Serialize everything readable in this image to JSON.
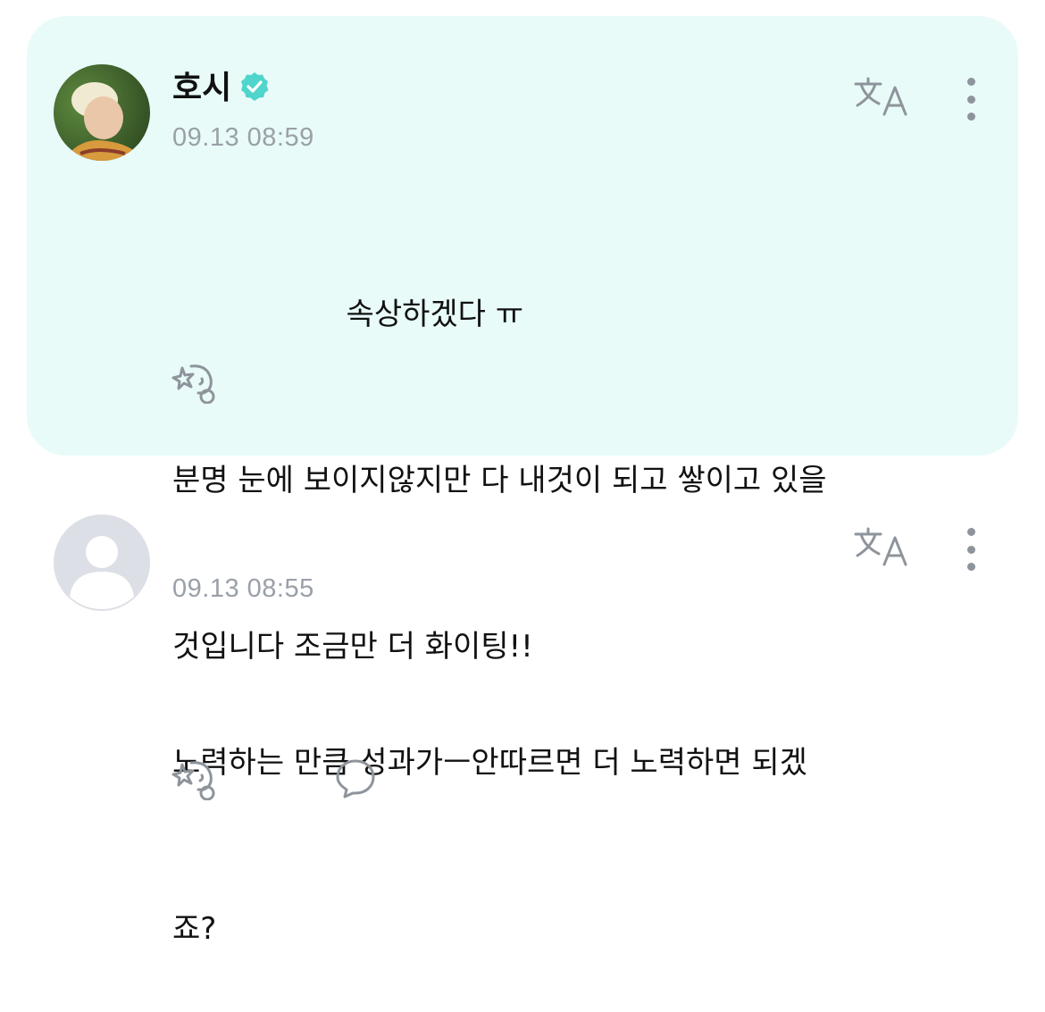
{
  "post": {
    "author": "호시",
    "verified": true,
    "timestamp": "09.13 08:59",
    "lines": [
      "                  속상하겠다 ㅠ",
      "분명 눈에 보이지않지만 다 내것이 되고 쌓이고 있을",
      "것입니다 조금만 더 화이팅!!"
    ],
    "background_color": "#e8fbf9"
  },
  "reply": {
    "timestamp": "09.13 08:55",
    "lines": [
      "노력하는 만큼 성과가ㅡ안따르면 더 노력하면 되겠",
      "죠?"
    ]
  },
  "icons": {
    "translate": "translate-icon",
    "more": "more-vertical-icon",
    "reaction": "add-reaction-icon",
    "comment": "comment-bubble-icon",
    "verified": "verified-badge-icon"
  },
  "colors": {
    "verified": "#4fd5cc",
    "icon_gray": "#8e949b",
    "timestamp": "#9aa0a8"
  }
}
